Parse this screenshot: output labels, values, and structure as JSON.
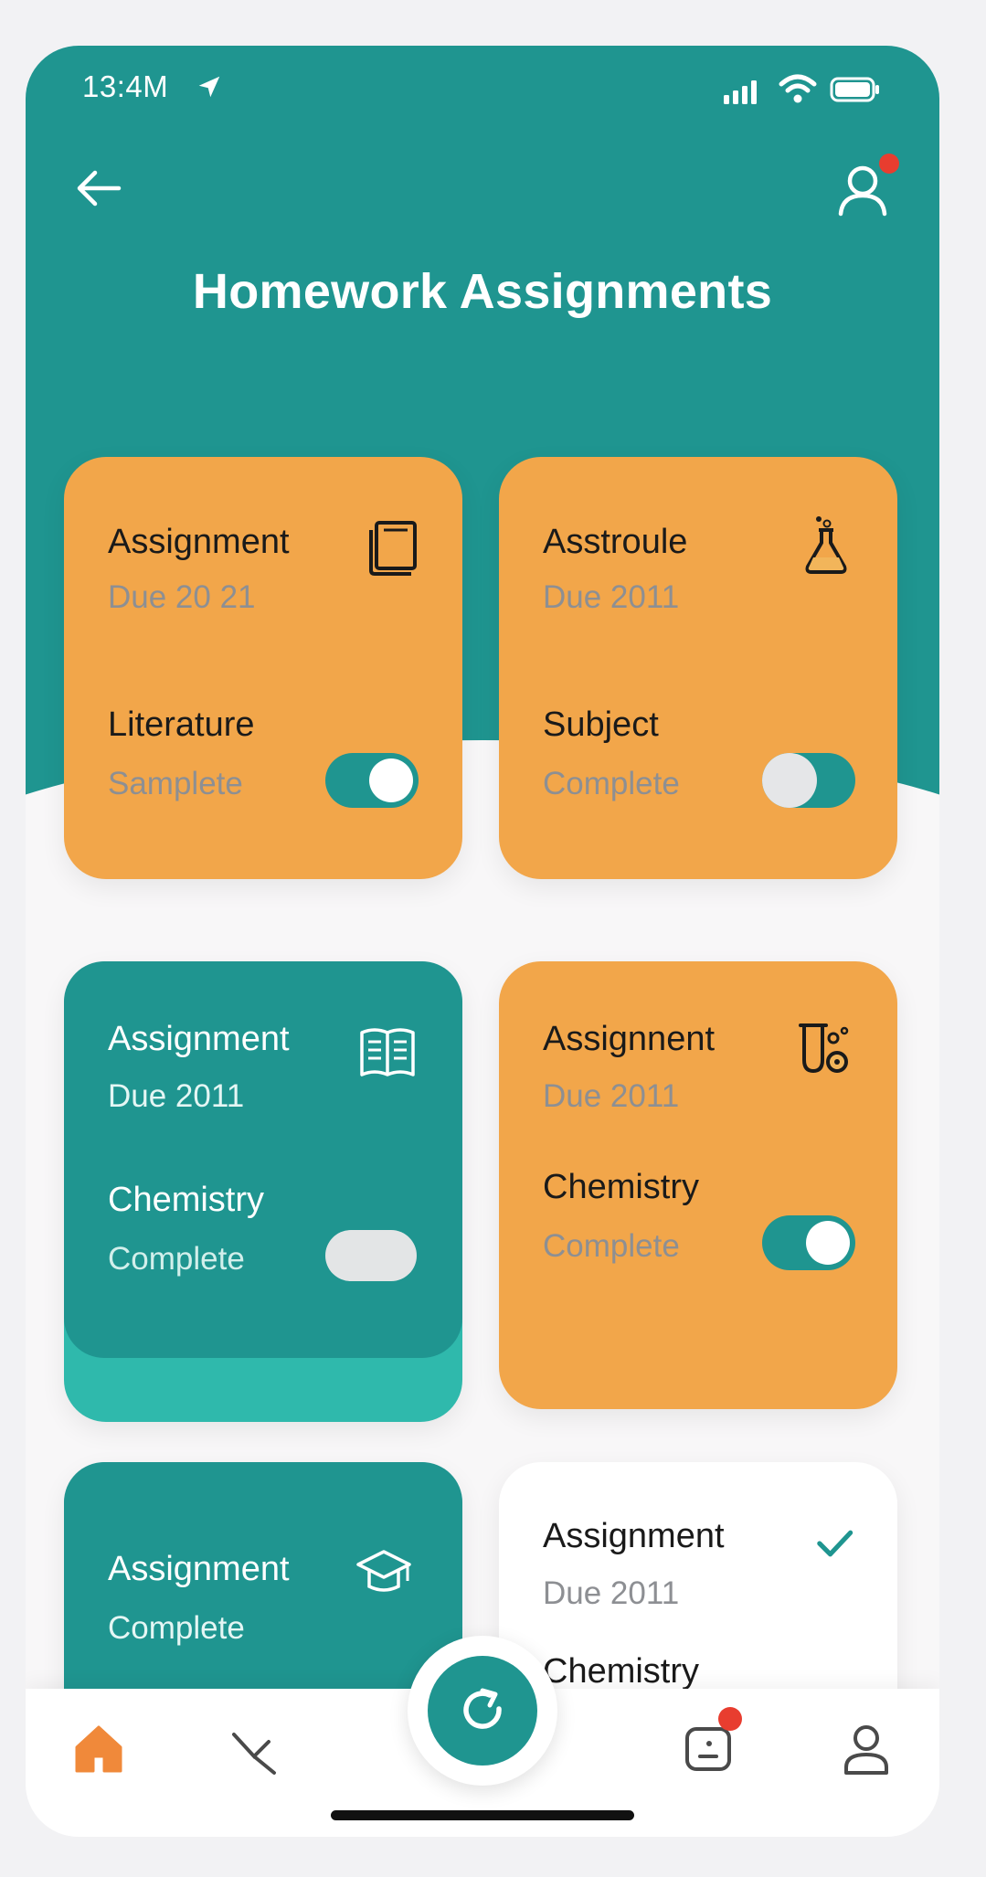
{
  "status_bar": {
    "time": "13:4M"
  },
  "header": {
    "title": "Homework Assignments"
  },
  "colors": {
    "teal": "#1f9590",
    "orange": "#f2a64a",
    "light_teal": "#2fb9ac",
    "alert_red": "#e83d2f"
  },
  "cards": [
    {
      "title": "Assignment",
      "due": "Due 20 21",
      "subject": "Literature",
      "status": "Samplete",
      "icon": "book-icon",
      "toggle": "on"
    },
    {
      "title": "Asstroule",
      "due": "Due 2011",
      "subject": "Subject",
      "status": "Complete",
      "icon": "flask-icon",
      "toggle": "on"
    },
    {
      "title": "Assignment",
      "due": "Due 2011",
      "subject": "Chemistry",
      "status": "Complete",
      "icon": "open-book-icon",
      "toggle": "off"
    },
    {
      "title": "Assignnent",
      "due": "Due 2011",
      "subject": "Chemistry",
      "status": "Complete",
      "icon": "lab-tubes-icon",
      "toggle": "on"
    },
    {
      "title": "Assignment",
      "status": "Complete",
      "icon": "graduation-cap-icon"
    },
    {
      "title": "Assignment",
      "due": "Due 2011",
      "subject": "Chemistry",
      "icon": "check-icon"
    }
  ],
  "tabbar": {
    "items": [
      "home-icon",
      "tools-icon",
      "refresh-icon",
      "messages-icon",
      "profile-icon"
    ]
  }
}
